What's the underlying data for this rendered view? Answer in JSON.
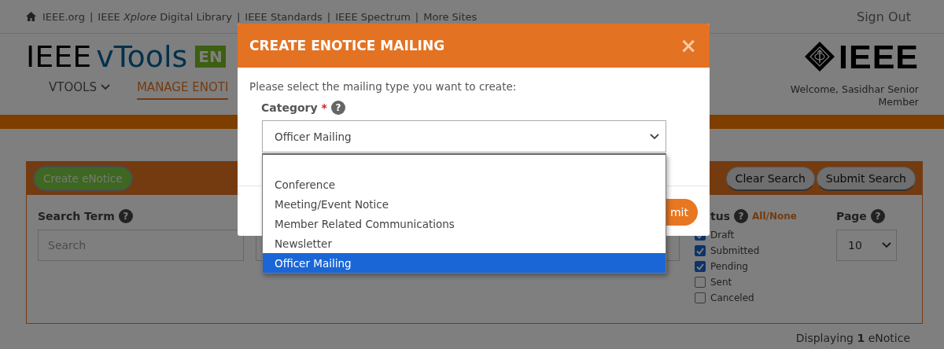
{
  "top_bar": {
    "items": [
      {
        "kind": "link",
        "label": "IEEE.org"
      },
      {
        "kind": "separator",
        "label": "|"
      },
      {
        "kind": "link",
        "label": "IEEE *Xplore* Digital Library"
      },
      {
        "kind": "separator",
        "label": "|"
      },
      {
        "kind": "link",
        "label": "IEEE Standards"
      },
      {
        "kind": "separator",
        "label": "|"
      },
      {
        "kind": "link",
        "label": "IEEE Spectrum"
      },
      {
        "kind": "separator",
        "label": "|"
      },
      {
        "kind": "link",
        "label": "More Sites"
      }
    ],
    "sign_out": "Sign Out"
  },
  "header": {
    "brand_prefix": "IEEE",
    "brand_name": "vTools",
    "badge": "EN",
    "nav": [
      {
        "label": "VTOOLS",
        "dropdown": true,
        "selected": false
      },
      {
        "label": "MANAGE ENOTI",
        "dropdown": false,
        "selected": true
      }
    ],
    "logo_text": "IEEE",
    "welcome": "Welcome, Sasidhar Senior Member"
  },
  "panel": {
    "create_button": "Create eNotice",
    "clear_button": "Clear Search",
    "submit_button": "Submit Search",
    "search_label": "Search Term",
    "search_help": "?",
    "search_placeholder": "Search",
    "status_label": "tus",
    "status_help": "?",
    "status_toggle": "All/None",
    "statuses": [
      {
        "label": "Draft",
        "checked": true
      },
      {
        "label": "Submitted",
        "checked": true
      },
      {
        "label": "Pending",
        "checked": true
      },
      {
        "label": "Sent",
        "checked": false
      },
      {
        "label": "Canceled",
        "checked": false
      }
    ],
    "page_label": "Page",
    "page_help": "?",
    "page_value": "10"
  },
  "footer_count": "Displaying **1** eNotice",
  "modal": {
    "title": "CREATE ENOTICE MAILING",
    "close": "×",
    "prompt": "Please select the mailing type you want to create:",
    "category_label": "Category",
    "required_mark": "*",
    "category_help": "?",
    "select_value": "Officer Mailing",
    "options": [
      {
        "kind": "blank",
        "selected": false
      },
      {
        "kind": "option",
        "label": "Conference",
        "selected": false
      },
      {
        "kind": "option",
        "label": "Meeting/Event Notice",
        "selected": false
      },
      {
        "kind": "option",
        "label": "Member Related Communications",
        "selected": false
      },
      {
        "kind": "option",
        "label": "Newsletter",
        "selected": false
      },
      {
        "kind": "option",
        "label": "Officer Mailing",
        "selected": true
      }
    ],
    "submit": "mit"
  }
}
